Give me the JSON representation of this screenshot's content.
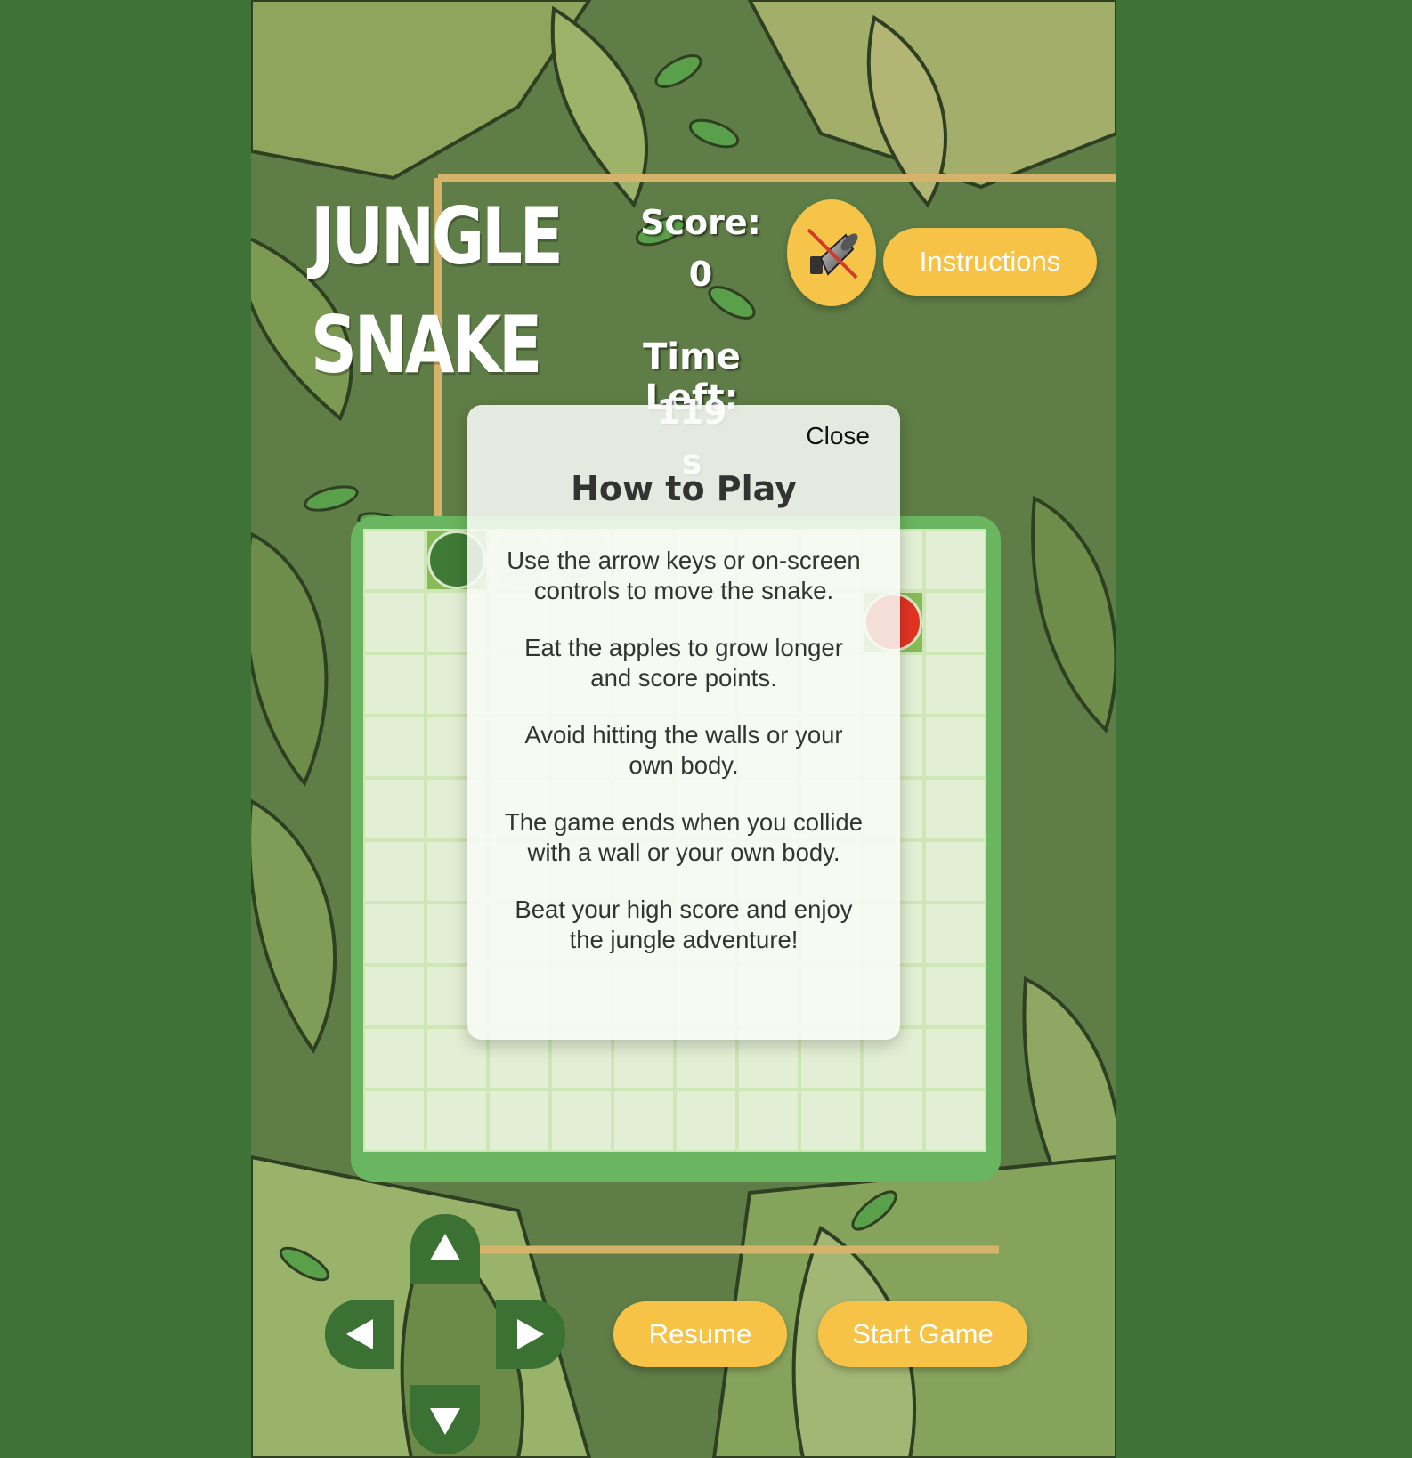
{
  "game": {
    "title_line1": "JUNGLE",
    "title_line2": "SNAKE"
  },
  "hud": {
    "score_label": "Score:",
    "score_value": "0",
    "time_label": "Time Left:",
    "time_value": "119",
    "time_unit": "s"
  },
  "sound": {
    "icon": "speaker-muted-icon",
    "muted": true
  },
  "buttons": {
    "instructions": "Instructions",
    "resume": "Resume",
    "start_game": "Start Game"
  },
  "controls": {
    "up": "▲",
    "down": "▼",
    "left": "◀",
    "right": "▶"
  },
  "board": {
    "rows": 10,
    "cols": 10,
    "snake": [
      [
        1,
        0
      ],
      [
        2,
        0
      ],
      [
        3,
        0
      ]
    ],
    "apple": [
      8,
      1
    ]
  },
  "modal": {
    "close_label": "Close",
    "title": "How to Play",
    "paragraphs": [
      "Use the arrow keys or on-screen controls to move the snake.",
      "Eat the apples to grow longer and score points.",
      "Avoid hitting the walls or your own body.",
      "The game ends when you collide with a wall or your own body.",
      "Beat your high score and enjoy the jungle adventure!"
    ]
  },
  "colors": {
    "page_bg": "#3f7237",
    "accent_yellow": "#f6c347",
    "board_border": "#6ab55f",
    "cell": "#e3efd4",
    "snake_head": "#3f7a36",
    "apple": "#e23322",
    "dpad": "#3b7133"
  }
}
